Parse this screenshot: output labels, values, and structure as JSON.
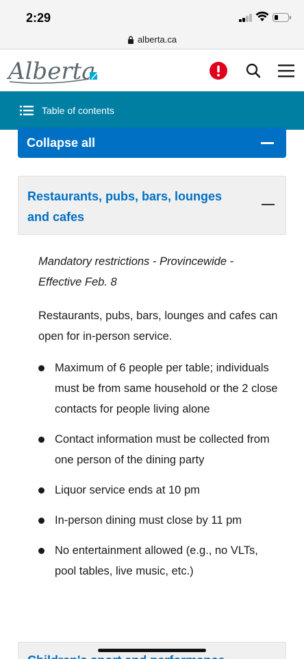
{
  "status_bar": {
    "time": "2:29"
  },
  "browser": {
    "url": "alberta.ca"
  },
  "header": {
    "logo_text": "Alberta",
    "alert_icon": "exclamation-circle",
    "search_icon": "magnifier",
    "menu_icon": "hamburger",
    "colors": {
      "alert": "#e0001b",
      "logo": "#5b6770",
      "logo_accent": "#00aad2"
    }
  },
  "toc": {
    "label": "Table of contents",
    "icon": "list",
    "color": "#007fa3"
  },
  "collapse_all": {
    "label": "Collapse all",
    "color": "#0070c4"
  },
  "accordion": {
    "title": "Restaurants, pubs, bars, lounges and cafes",
    "subtitle": "Mandatory restrictions - Provincewide - Effective Feb. 8",
    "intro": "Restaurants, pubs, bars, lounges and cafes can open for in-person service.",
    "bullets": [
      "Maximum of 6 people per table; individuals must be from same household or the 2 close contacts for people living alone",
      "Contact information must be collected from one person of the dining party",
      "Liquor service ends at 10 pm",
      "In-person dining must close by 11 pm",
      "No entertainment allowed (e.g., no VLTs, pool tables, live music, etc.)"
    ]
  },
  "next_accordion": {
    "title": "Children's sport and performance"
  }
}
